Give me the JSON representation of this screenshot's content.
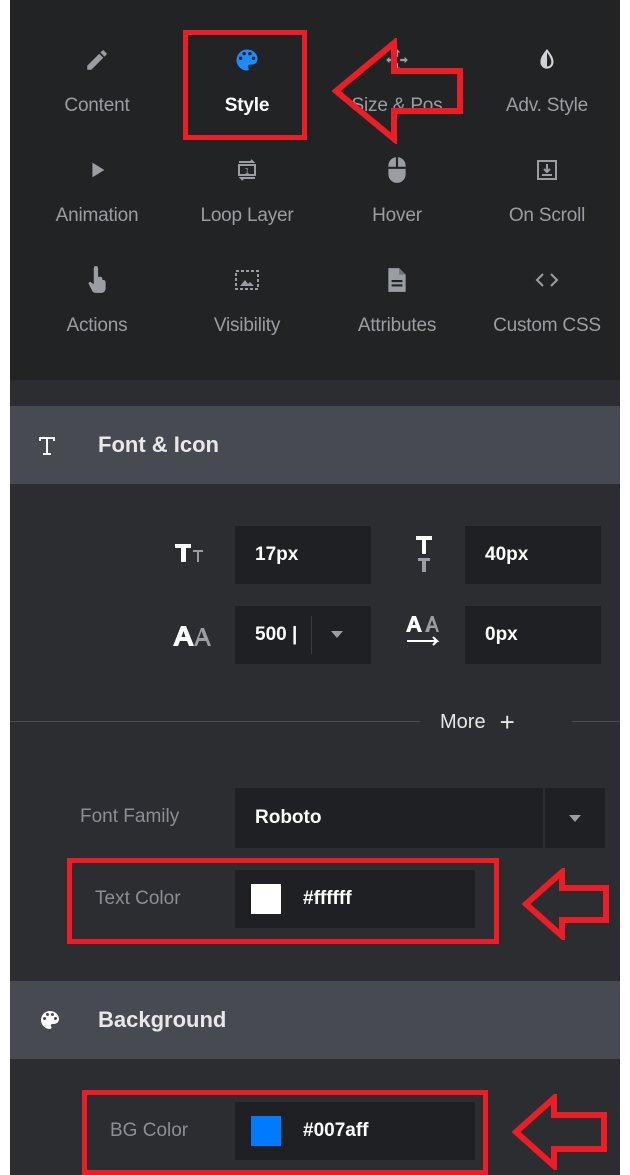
{
  "tabs": [
    {
      "label": "Content",
      "icon": "pencil-icon"
    },
    {
      "label": "Style",
      "icon": "palette-icon",
      "active": true
    },
    {
      "label": "Size & Pos",
      "icon": "move-icon"
    },
    {
      "label": "Adv. Style",
      "icon": "contrast-icon"
    },
    {
      "label": "Animation",
      "icon": "play-icon"
    },
    {
      "label": "Loop Layer",
      "icon": "loop-icon"
    },
    {
      "label": "Hover",
      "icon": "mouse-icon"
    },
    {
      "label": "On Scroll",
      "icon": "scroll-icon"
    },
    {
      "label": "Actions",
      "icon": "hand-pointer-icon"
    },
    {
      "label": "Visibility",
      "icon": "visibility-icon"
    },
    {
      "label": "Attributes",
      "icon": "document-icon"
    },
    {
      "label": "Custom CSS",
      "icon": "code-icon"
    }
  ],
  "font_section": {
    "title": "Font & Icon",
    "font_size": "17px",
    "line_height": "40px",
    "font_weight": "500 |",
    "letter_spacing": "0px",
    "more_label": "More",
    "font_family_label": "Font Family",
    "font_family": "Roboto",
    "text_color_label": "Text Color",
    "text_color": "#ffffff"
  },
  "background_section": {
    "title": "Background",
    "bg_color_label": "BG Color",
    "bg_color": "#007aff"
  },
  "colors": {
    "accent": "#1a8cff",
    "annotation": "#ee1c25"
  }
}
